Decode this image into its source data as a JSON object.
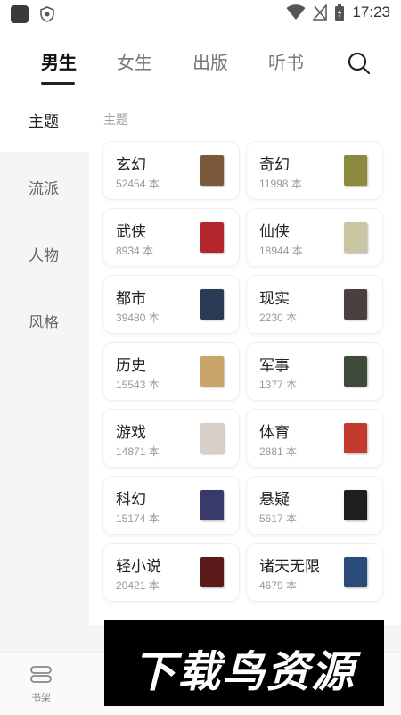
{
  "status_bar": {
    "time": "17:23"
  },
  "top_tabs": [
    {
      "label": "男生",
      "active": true
    },
    {
      "label": "女生",
      "active": false
    },
    {
      "label": "出版",
      "active": false
    },
    {
      "label": "听书",
      "active": false
    }
  ],
  "sidebar": {
    "items": [
      {
        "label": "主题",
        "active": true
      },
      {
        "label": "流派",
        "active": false
      },
      {
        "label": "人物",
        "active": false
      },
      {
        "label": "风格",
        "active": false
      }
    ]
  },
  "main": {
    "section_title": "主题",
    "categories": [
      {
        "name": "玄幻",
        "count": "52454 本",
        "cover_color": "#7a5a3a"
      },
      {
        "name": "奇幻",
        "count": "11998 本",
        "cover_color": "#8c8a3f"
      },
      {
        "name": "武侠",
        "count": "8934 本",
        "cover_color": "#b3262b"
      },
      {
        "name": "仙侠",
        "count": "18944 本",
        "cover_color": "#c9c6a3"
      },
      {
        "name": "都市",
        "count": "39480 本",
        "cover_color": "#2a3a55"
      },
      {
        "name": "现实",
        "count": "2230 本",
        "cover_color": "#4a4040"
      },
      {
        "name": "历史",
        "count": "15543 本",
        "cover_color": "#c9a56a"
      },
      {
        "name": "军事",
        "count": "1377 本",
        "cover_color": "#3d4a3a"
      },
      {
        "name": "游戏",
        "count": "14871 本",
        "cover_color": "#d8d0c8"
      },
      {
        "name": "体育",
        "count": "2881 本",
        "cover_color": "#c23b2e"
      },
      {
        "name": "科幻",
        "count": "15174 本",
        "cover_color": "#3a3a6a"
      },
      {
        "name": "悬疑",
        "count": "5617 本",
        "cover_color": "#1f1f1f"
      },
      {
        "name": "轻小说",
        "count": "20421 本",
        "cover_color": "#5a1a1a"
      },
      {
        "name": "诸天无限",
        "count": "4679 本",
        "cover_color": "#2a4a7a"
      }
    ]
  },
  "bottom_nav": {
    "shelf_label": "书架"
  },
  "watermark": {
    "text": "下载鸟资源"
  }
}
